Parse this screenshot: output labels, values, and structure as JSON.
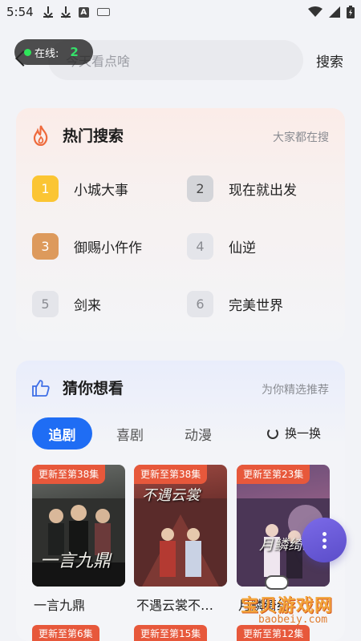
{
  "status_bar": {
    "time": "5:54"
  },
  "search": {
    "placeholder": "今天看点啥",
    "button_label": "搜索"
  },
  "online": {
    "label": "在线:",
    "count": "2"
  },
  "hot_search": {
    "title": "热门搜索",
    "subtitle": "大家都在搜",
    "items": [
      {
        "rank": "1",
        "title": "小城大事"
      },
      {
        "rank": "2",
        "title": "现在就出发"
      },
      {
        "rank": "3",
        "title": "御赐小仵作"
      },
      {
        "rank": "4",
        "title": "仙逆"
      },
      {
        "rank": "5",
        "title": "剑来"
      },
      {
        "rank": "6",
        "title": "完美世界"
      }
    ]
  },
  "guess": {
    "title": "猜你想看",
    "subtitle": "为你精选推荐",
    "tabs": [
      "追剧",
      "喜剧",
      "动漫"
    ],
    "refresh_label": "换一换",
    "posters": [
      {
        "badge": "更新至第38集",
        "title": "一言九鼎",
        "art_text": "一言九鼎"
      },
      {
        "badge": "更新至第38集",
        "title": "不遇云裳不…",
        "art_text": "不遇云裳"
      },
      {
        "badge": "更新至第23集",
        "title": "月鳞绮纪",
        "art_text": "月鳞绮纪"
      }
    ],
    "next_row_badges": [
      "更新至第6集",
      "更新至第15集",
      "更新至第12集"
    ]
  },
  "watermark": {
    "text": "宝贝游戏网",
    "url": "baobeiy.com"
  },
  "colors": {
    "accent": "#1f6df4",
    "badge": "#e7583b",
    "online_green": "#2ee55a",
    "fab": "#6b5bd8"
  }
}
